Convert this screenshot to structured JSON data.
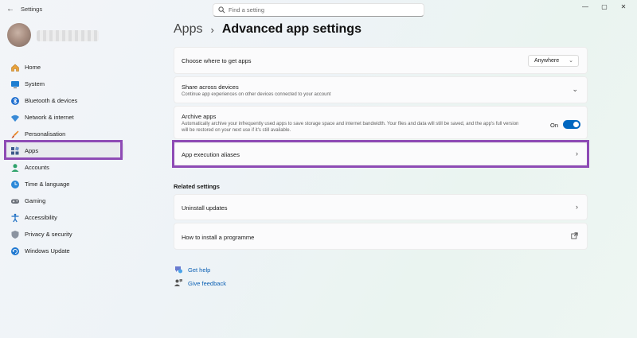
{
  "window": {
    "title": "Settings",
    "controls": {
      "minimize": "—",
      "maximize": "▢",
      "close": "✕"
    }
  },
  "search": {
    "placeholder": "Find a setting"
  },
  "sidebar": {
    "items": [
      {
        "label": "Home",
        "icon": "home-icon"
      },
      {
        "label": "System",
        "icon": "system-icon"
      },
      {
        "label": "Bluetooth & devices",
        "icon": "bluetooth-icon"
      },
      {
        "label": "Network & internet",
        "icon": "wifi-icon"
      },
      {
        "label": "Personalisation",
        "icon": "brush-icon"
      },
      {
        "label": "Apps",
        "icon": "apps-icon",
        "active": true
      },
      {
        "label": "Accounts",
        "icon": "person-icon"
      },
      {
        "label": "Time & language",
        "icon": "globe-clock-icon"
      },
      {
        "label": "Gaming",
        "icon": "gamepad-icon"
      },
      {
        "label": "Accessibility",
        "icon": "accessibility-icon"
      },
      {
        "label": "Privacy & security",
        "icon": "shield-icon"
      },
      {
        "label": "Windows Update",
        "icon": "update-icon"
      }
    ]
  },
  "header": {
    "parent": "Apps",
    "separator": "›",
    "current": "Advanced app settings"
  },
  "settings": {
    "choose_where": {
      "title": "Choose where to get apps",
      "value": "Anywhere"
    },
    "share_across": {
      "title": "Share across devices",
      "subtitle": "Continue app experiences on other devices connected to your account"
    },
    "archive_apps": {
      "title": "Archive apps",
      "subtitle_line1": "Automatically archive your infrequently used apps to save storage space and internet bandwidth. Your files and data will still be saved, and the app's full version",
      "subtitle_line2": "will be restored on your next use if it's still available.",
      "toggle_label": "On",
      "toggle_on": true
    },
    "app_execution_aliases": {
      "title": "App execution aliases"
    }
  },
  "related": {
    "header": "Related settings",
    "uninstall_updates": "Uninstall updates",
    "how_to_install": "How to install a programme"
  },
  "help": {
    "get_help": "Get help",
    "give_feedback": "Give feedback"
  },
  "colors": {
    "accent": "#0067c0",
    "highlight": "#8e4bb5"
  }
}
